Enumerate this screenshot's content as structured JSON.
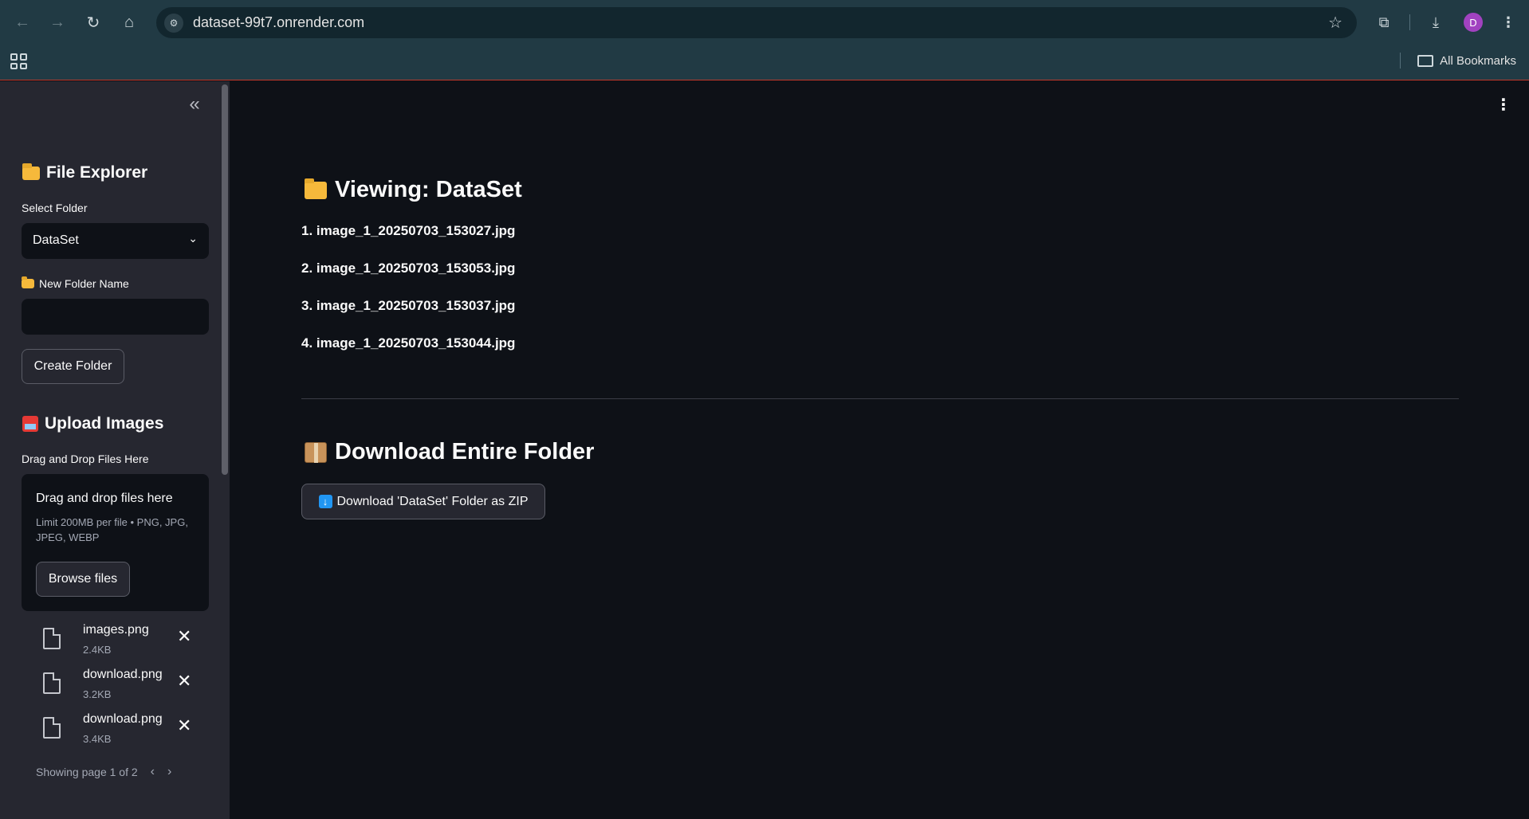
{
  "browser": {
    "url": "dataset-99t7.onrender.com",
    "avatar_letter": "D",
    "all_bookmarks": "All Bookmarks"
  },
  "sidebar": {
    "file_explorer_title": "File Explorer",
    "select_folder_label": "Select Folder",
    "selected_folder": "DataSet",
    "new_folder_label": "New Folder Name",
    "new_folder_value": "",
    "create_folder_button": "Create Folder",
    "upload_title": "Upload Images",
    "drag_drop_label": "Drag and Drop Files Here",
    "dropzone_title": "Drag and drop files here",
    "dropzone_sub": "Limit 200MB per file • PNG, JPG, JPEG, WEBP",
    "browse_button": "Browse files",
    "uploaded_files": [
      {
        "name": "images.png",
        "size": "2.4KB"
      },
      {
        "name": "download.png",
        "size": "3.2KB"
      },
      {
        "name": "download.png",
        "size": "3.4KB"
      }
    ],
    "pagination": "Showing page 1 of 2"
  },
  "main": {
    "viewing_title": "Viewing: DataSet",
    "files": [
      "1. image_1_20250703_153027.jpg",
      "2. image_1_20250703_153053.jpg",
      "3. image_1_20250703_153037.jpg",
      "4. image_1_20250703_153044.jpg"
    ],
    "download_title": "Download Entire Folder",
    "download_button": "Download 'DataSet' Folder as ZIP"
  }
}
